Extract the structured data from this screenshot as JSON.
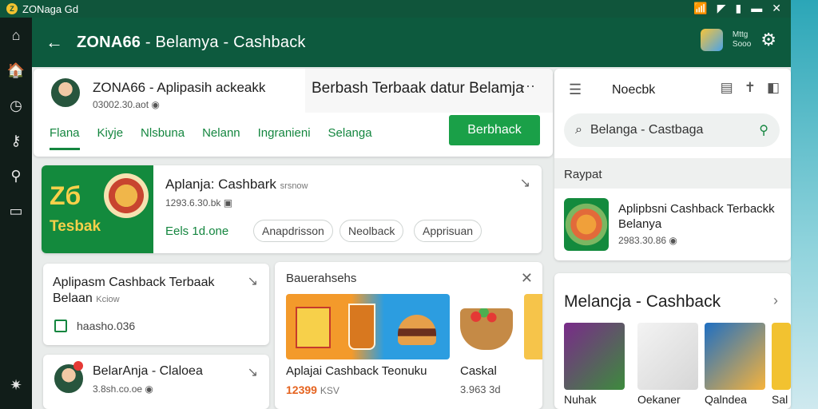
{
  "statusbar": {
    "title": "ZONaga Gd"
  },
  "header": {
    "title_main": "ZONA66",
    "title_rest": " - Belamya - Cashback",
    "mini_top": "Mttg",
    "mini_bottom": "Sooo"
  },
  "profile": {
    "name": "ZONA66 - Aplipasih ackeakk",
    "sub": "03002.30.aot",
    "banner_text": "Berbash Terbaak datur Belamja",
    "tabs": [
      "Flana",
      "Kiyje",
      "Nlsbuna",
      "Nelann",
      "Ingranieni",
      "Selanga"
    ],
    "cta": "Berbhack"
  },
  "feature": {
    "img_num": "Zб",
    "img_label": "Tesbak",
    "title": "Aplanja: Cashbark",
    "title_suffix": "srsnow",
    "sub": "1293.6.30.bk",
    "green": "Eels 1d.one",
    "pills": [
      "Anapdrisson",
      "Neolback",
      "Apprisuan"
    ]
  },
  "left_card_1": {
    "title": "Aplipasm Cashback Terbaak Belaan",
    "small": "Kciow",
    "value": "haasho.036"
  },
  "left_card_2": {
    "title": "BelarAnja - Claloea",
    "sub": "3.8sh.co.oe"
  },
  "middle_card": {
    "header": "Bauerahsehs",
    "p1_title": "Aplajai Cashback Teonuku",
    "p1_price": "12399",
    "p1_suffix": "KSV",
    "p2_title": "Caskal",
    "p2_sub": "3.963 3d"
  },
  "right_panel": {
    "title": "Noecbk",
    "search_value": "Belanga - Castbaga",
    "section": "Raypat",
    "item_title": "Aplipbsni Cashback Terbackk Belanya",
    "item_sub": "2983.30.86"
  },
  "right_lower": {
    "title": "Melancja - Cashback",
    "captions": [
      "Nuhak",
      "Oekaner",
      "Qalndea",
      "Sal"
    ]
  },
  "icons": {
    "back": "arrow-left-icon",
    "gear": "gear-icon",
    "menu": "hamburger-menu-icon",
    "search": "search-icon",
    "close": "close-icon"
  },
  "colors": {
    "header": "#0d5a3e",
    "accent": "#1aa048",
    "price": "#e5631f"
  }
}
